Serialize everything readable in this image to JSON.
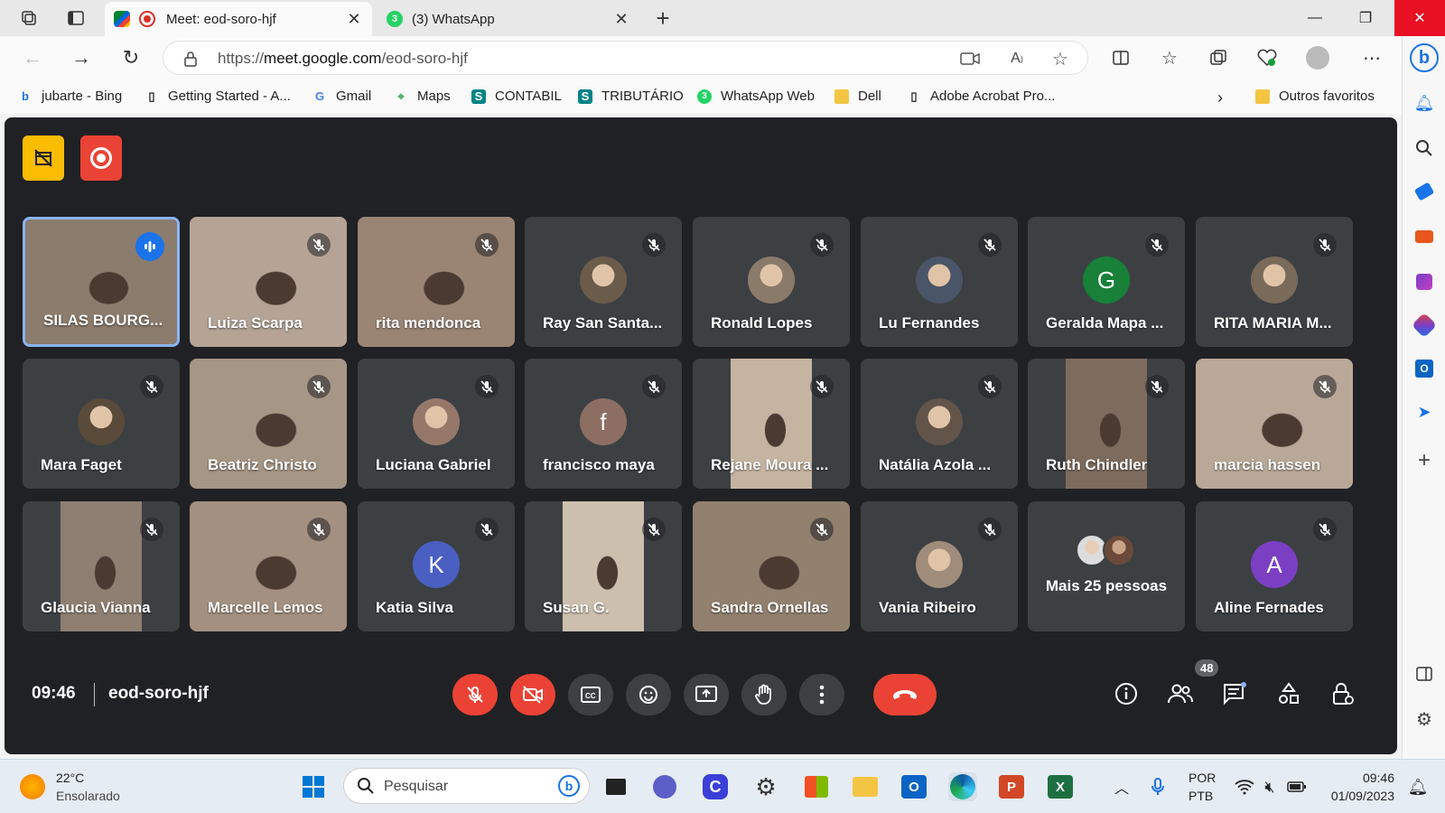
{
  "browser": {
    "tabs": [
      {
        "label": "Meet: eod-soro-hjf",
        "active": true
      },
      {
        "label": "(3) WhatsApp",
        "active": false
      }
    ],
    "url_scheme": "https://",
    "url_host": "meet.google.com",
    "url_path": "/eod-soro-hjf",
    "bookmarks": [
      {
        "label": "jubarte - Bing",
        "icon": "bing-icon"
      },
      {
        "label": "Getting Started - A...",
        "icon": "page-icon"
      },
      {
        "label": "Gmail",
        "icon": "google-icon"
      },
      {
        "label": "Maps",
        "icon": "maps-icon"
      },
      {
        "label": "CONTABIL",
        "icon": "sharepoint-icon"
      },
      {
        "label": "TRIBUTÁRIO",
        "icon": "sharepoint-icon"
      },
      {
        "label": "WhatsApp Web",
        "icon": "whatsapp-icon"
      },
      {
        "label": "Dell",
        "icon": "folder-icon"
      },
      {
        "label": "Adobe Acrobat Pro...",
        "icon": "page-icon"
      }
    ],
    "other_favorites": "Outros favoritos",
    "tab_badge": "3"
  },
  "meet": {
    "time": "09:46",
    "meeting_code": "eod-soro-hjf",
    "participant_count": "48",
    "participants": [
      {
        "name": "SILAS BOURG...",
        "type": "video",
        "speaking": true,
        "muted": false
      },
      {
        "name": "Luiza Scarpa",
        "type": "video",
        "muted": true
      },
      {
        "name": "rita mendonca",
        "type": "video",
        "muted": true
      },
      {
        "name": "Ray San Santa...",
        "type": "photo",
        "muted": true
      },
      {
        "name": "Ronald Lopes",
        "type": "photo",
        "muted": true
      },
      {
        "name": "Lu Fernandes",
        "type": "photo",
        "muted": true
      },
      {
        "name": "Geralda Mapa ...",
        "type": "initial",
        "initial": "G",
        "color": "#188038",
        "muted": true
      },
      {
        "name": "RITA MARIA M...",
        "type": "photo",
        "muted": true
      },
      {
        "name": "Mara Faget",
        "type": "photo",
        "muted": true
      },
      {
        "name": "Beatriz Christo",
        "type": "video",
        "muted": true
      },
      {
        "name": "Luciana Gabriel",
        "type": "photo",
        "muted": true
      },
      {
        "name": "francisco maya",
        "type": "initial",
        "initial": "f",
        "color": "#8d6e63",
        "muted": true
      },
      {
        "name": "Rejane Moura ...",
        "type": "video",
        "muted": true
      },
      {
        "name": "Natália Azola ...",
        "type": "photo",
        "muted": true
      },
      {
        "name": "Ruth Chindler",
        "type": "video",
        "muted": true
      },
      {
        "name": "marcia hassen",
        "type": "video",
        "muted": true
      },
      {
        "name": "Glaucia Vianna",
        "type": "video",
        "muted": true
      },
      {
        "name": "Marcelle Lemos",
        "type": "video",
        "muted": true
      },
      {
        "name": "Katia Silva",
        "type": "initial",
        "initial": "K",
        "color": "#4a5fc1",
        "muted": true
      },
      {
        "name": "Susan G.",
        "type": "video",
        "muted": true
      },
      {
        "name": "Sandra Ornellas",
        "type": "video",
        "muted": true
      },
      {
        "name": "Vania Ribeiro",
        "type": "photo",
        "muted": true
      },
      {
        "name": "Mais 25 pessoas",
        "type": "more",
        "muted": false
      },
      {
        "name": "Aline Fernades",
        "type": "initial",
        "initial": "A",
        "color": "#7b3fc4",
        "muted": true
      }
    ]
  },
  "taskbar": {
    "weather_temp": "22°C",
    "weather_desc": "Ensolarado",
    "search_placeholder": "Pesquisar",
    "lang_1": "POR",
    "lang_2": "PTB",
    "time": "09:46",
    "date": "01/09/2023"
  }
}
